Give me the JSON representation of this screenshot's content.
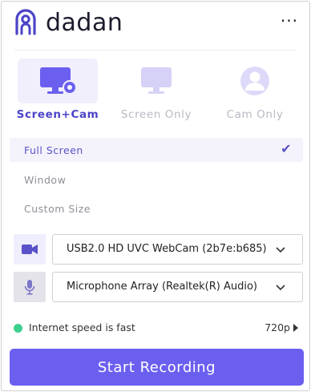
{
  "header": {
    "brand": "dadan",
    "menu_label": "···"
  },
  "modes": [
    {
      "label": "Screen+Cam",
      "icon": "screen-cam-icon",
      "active": true
    },
    {
      "label": "Screen Only",
      "icon": "monitor-icon",
      "active": false
    },
    {
      "label": "Cam Only",
      "icon": "user-icon",
      "active": false
    }
  ],
  "size_options": [
    {
      "label": "Full Screen",
      "selected": true
    },
    {
      "label": "Window",
      "selected": false
    },
    {
      "label": "Custom Size",
      "selected": false
    }
  ],
  "camera": {
    "icon": "video-camera-icon",
    "value": "USB2.0 HD UVC WebCam (2b7e:b685)"
  },
  "microphone": {
    "icon": "microphone-icon",
    "value": "Microphone Array (Realtek(R) Audio)"
  },
  "status": {
    "speed_text": "Internet speed is fast",
    "resolution": "720p"
  },
  "start_button": {
    "label": "Start Recording"
  },
  "colors": {
    "accent": "#6b5ff0",
    "accent_dark": "#4b43c8",
    "status_green": "#3ccf8e"
  }
}
